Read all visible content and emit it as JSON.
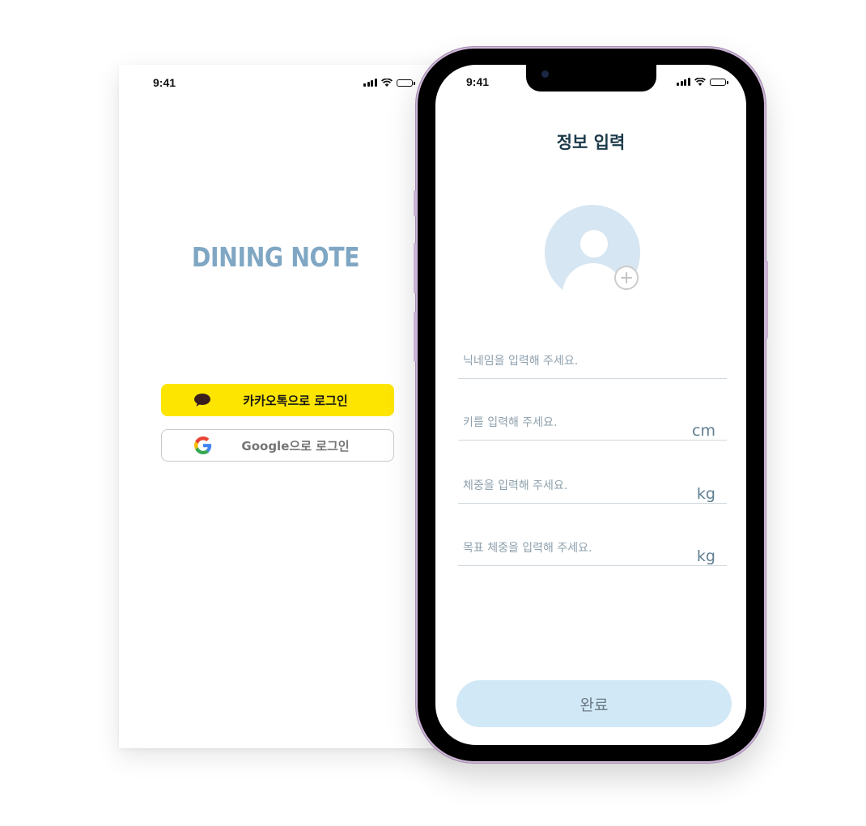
{
  "login_screen": {
    "status_bar": {
      "time": "9:41"
    },
    "brand": {
      "logo_text": "DINING NOTE",
      "color": "#7fa7c4"
    },
    "buttons": {
      "kakao": {
        "label": "카카오톡으로 로그인",
        "icon": "kakao-speech-bubble-icon",
        "color": "#fee500"
      },
      "google": {
        "label": "Google으로 로그인",
        "icon": "google-g-icon"
      }
    }
  },
  "profile_screen": {
    "status_bar": {
      "time": "9:41"
    },
    "title": "정보 입력",
    "avatar": {
      "icon": "user-avatar-icon",
      "add_icon": "plus-circle-icon"
    },
    "fields": {
      "nickname": {
        "placeholder": "닉네임을 입력해 주세요.",
        "value": ""
      },
      "height": {
        "placeholder": "키를 입력해 주세요.",
        "unit": "cm",
        "value": ""
      },
      "weight": {
        "placeholder": "체중을 입력해 주세요.",
        "unit": "kg",
        "value": ""
      },
      "target_weight": {
        "placeholder": "목표 체중을 입력해 주세요.",
        "unit": "kg",
        "value": ""
      }
    },
    "submit": {
      "label": "완료",
      "color": "#d1e8f6"
    }
  },
  "colors": {
    "title_text": "#1c3a4a",
    "unit_text": "#5f7f91",
    "placeholder_text": "#8ea0ad",
    "phone_frame_accent": "#cdb6d6"
  }
}
